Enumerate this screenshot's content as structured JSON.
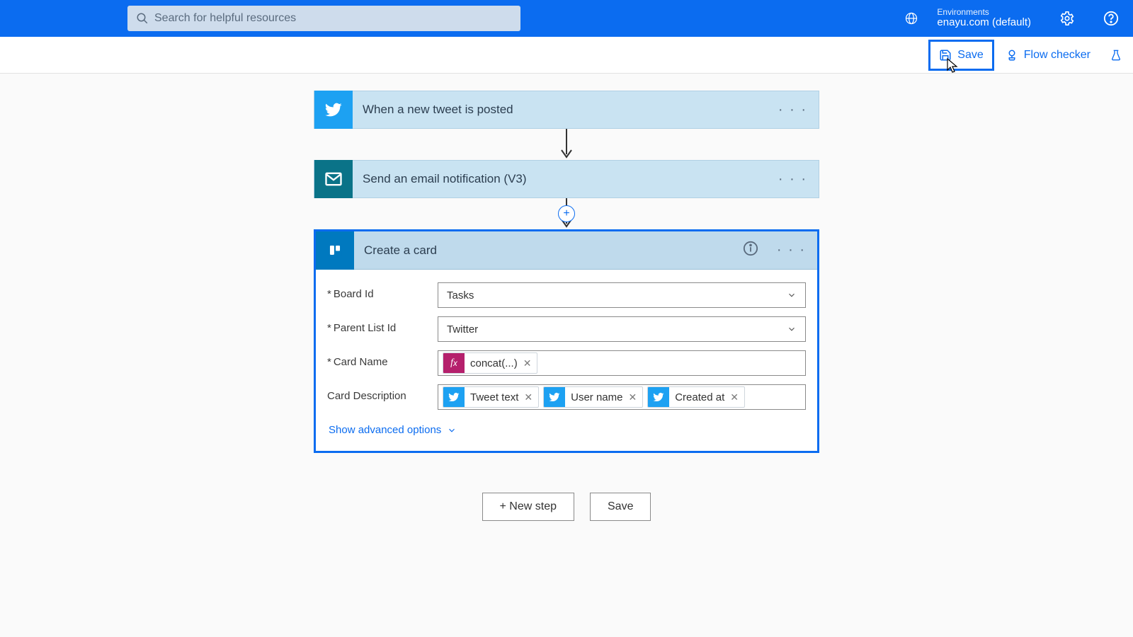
{
  "header": {
    "search_placeholder": "Search for helpful resources",
    "env_label": "Environments",
    "env_value": "enayu.com (default)"
  },
  "toolbar": {
    "save": "Save",
    "flow_checker": "Flow checker"
  },
  "steps": {
    "s1_title": "When a new tweet is posted",
    "s2_title": "Send an email notification (V3)",
    "s3_title": "Create a card"
  },
  "form": {
    "board_label": "Board Id",
    "board_value": "Tasks",
    "parent_label": "Parent List Id",
    "parent_value": "Twitter",
    "cardname_label": "Card Name",
    "cardname_token": "concat(...)",
    "desc_label": "Card Description",
    "desc_tokens": {
      "t1": "Tweet text",
      "t2": "User name",
      "t3": "Created at"
    },
    "advanced": "Show advanced options"
  },
  "bottom": {
    "new_step": "+ New step",
    "save": "Save"
  }
}
